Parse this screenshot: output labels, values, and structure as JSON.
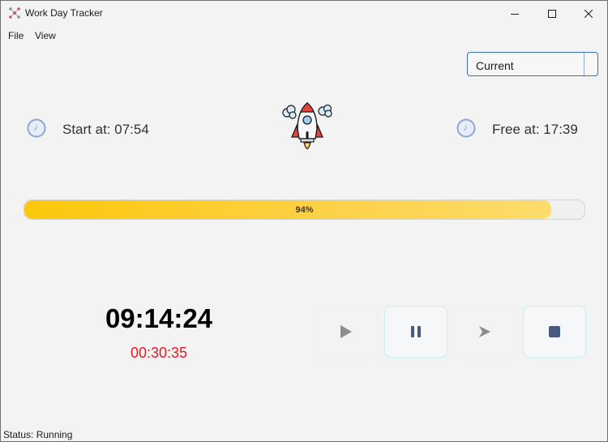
{
  "window": {
    "title": "Work Day Tracker"
  },
  "menu": {
    "file": "File",
    "view": "View"
  },
  "period_select": {
    "selected": "Current"
  },
  "start": {
    "label": "Start at: 07:54",
    "icon": "clock-icon"
  },
  "free": {
    "label": "Free at: 17:39",
    "icon": "clock-icon"
  },
  "progress": {
    "percent": 94,
    "label": "94%",
    "color": "#fdc70a"
  },
  "timer": {
    "main": "09:14:24",
    "extra": "00:30:35",
    "extra_color": "#e8171e"
  },
  "controls": {
    "play": "play-icon",
    "pause": "pause-icon",
    "next": "next-icon",
    "stop": "stop-icon"
  },
  "status": {
    "text": "Status: Running"
  }
}
